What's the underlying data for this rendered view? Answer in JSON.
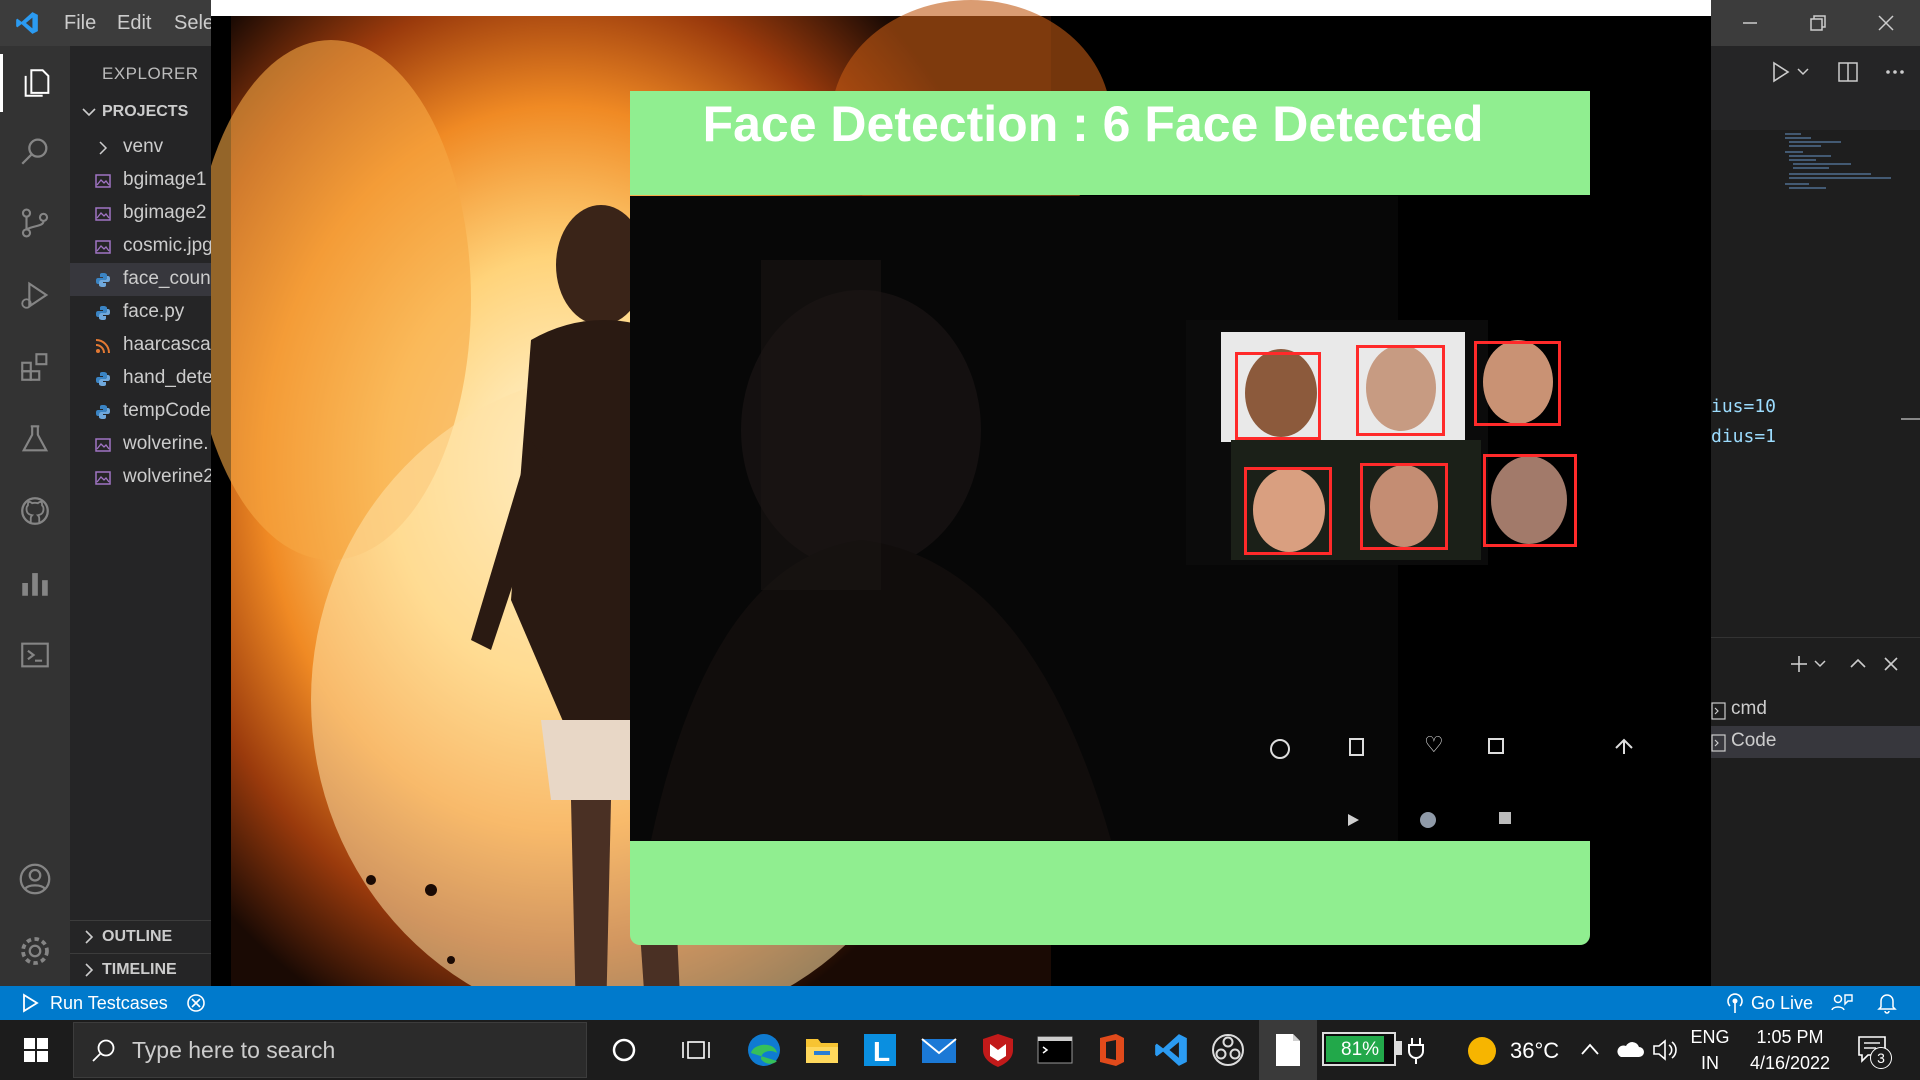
{
  "vscode": {
    "menu": [
      "File",
      "Edit",
      "Sele"
    ],
    "explorer_title": "EXPLORER",
    "projects_label": "PROJECTS",
    "files": [
      {
        "name": "venv",
        "type": "folder"
      },
      {
        "name": "bgimage1",
        "type": "image"
      },
      {
        "name": "bgimage2",
        "type": "image"
      },
      {
        "name": "cosmic.jpg",
        "type": "image"
      },
      {
        "name": "face_coun",
        "type": "python",
        "selected": true
      },
      {
        "name": "face.py",
        "type": "python"
      },
      {
        "name": "haarcascad",
        "type": "xml"
      },
      {
        "name": "hand_dete",
        "type": "python"
      },
      {
        "name": "tempCode",
        "type": "python"
      },
      {
        "name": "wolverine.",
        "type": "image"
      },
      {
        "name": "wolverine2",
        "type": "image"
      }
    ],
    "outline_label": "OUTLINE",
    "timeline_label": "TIMELINE",
    "code_fragments": [
      "ius=10",
      "dius=1"
    ],
    "terminals": [
      "cmd",
      "Code"
    ],
    "status_left": "Run Testcases",
    "status_right": "Go Live"
  },
  "app": {
    "title": "Face Detection : 6 Face Detected",
    "banner_color": "#90ee90",
    "box_color": "#ff2a2a"
  },
  "taskbar": {
    "search_placeholder": "Type here to search",
    "battery": "81%",
    "weather_temp": "36°C",
    "lang_line1": "ENG",
    "lang_line2": "IN",
    "time": "1:05 PM",
    "date": "4/16/2022",
    "notifications": "3"
  }
}
